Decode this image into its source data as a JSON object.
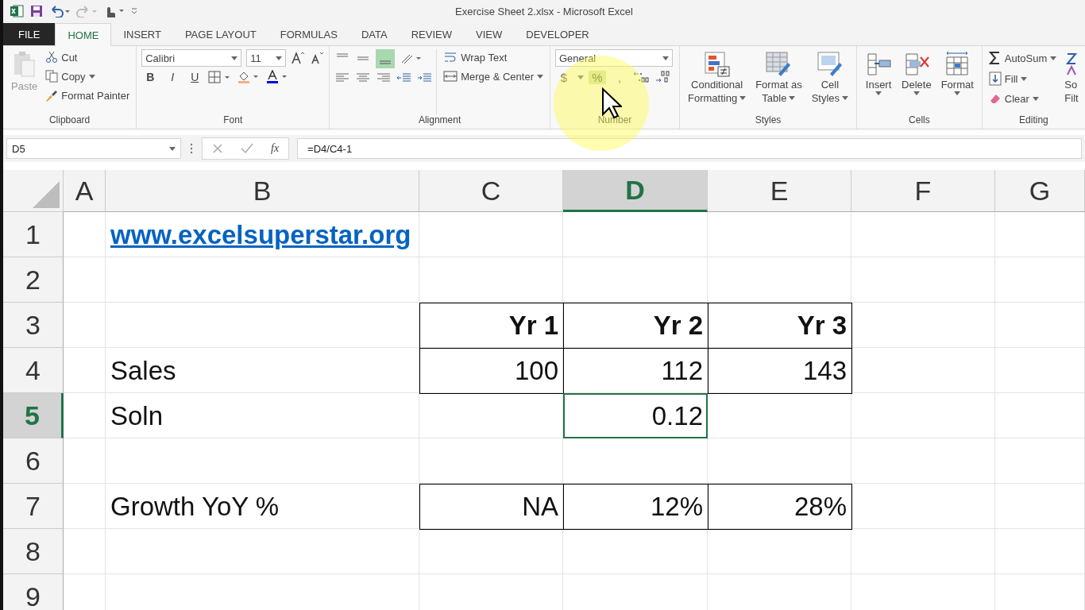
{
  "window": {
    "title": "Exercise Sheet 2.xlsx - Microsoft Excel"
  },
  "tabs": [
    {
      "label": "FILE",
      "selected": false,
      "kind": "file"
    },
    {
      "label": "HOME",
      "selected": true,
      "kind": "tab"
    },
    {
      "label": "INSERT",
      "selected": false,
      "kind": "tab"
    },
    {
      "label": "PAGE LAYOUT",
      "selected": false,
      "kind": "tab"
    },
    {
      "label": "FORMULAS",
      "selected": false,
      "kind": "tab"
    },
    {
      "label": "DATA",
      "selected": false,
      "kind": "tab"
    },
    {
      "label": "REVIEW",
      "selected": false,
      "kind": "tab"
    },
    {
      "label": "VIEW",
      "selected": false,
      "kind": "tab"
    },
    {
      "label": "DEVELOPER",
      "selected": false,
      "kind": "tab"
    }
  ],
  "ribbon": {
    "clipboard": {
      "paste": "Paste",
      "cut": "Cut",
      "copy": "Copy",
      "format_painter": "Format Painter",
      "label": "Clipboard"
    },
    "font": {
      "name": "Calibri",
      "points": "11",
      "bold": "B",
      "italic": "I",
      "underline": "U",
      "label": "Font"
    },
    "alignment": {
      "wrap_text": "Wrap Text",
      "merge": "Merge & Center",
      "label": "Alignment"
    },
    "number": {
      "format": "General",
      "currency": "$",
      "percent": "%",
      "comma": ",",
      "label": "Number"
    },
    "styles": {
      "conditional": [
        "Conditional",
        "Formatting"
      ],
      "format_table": [
        "Format as",
        "Table"
      ],
      "cell_styles": [
        "Cell",
        "Styles"
      ],
      "label": "Styles"
    },
    "cells": {
      "insert": "Insert",
      "delete": "Delete",
      "format": "Format",
      "label": "Cells"
    },
    "editing": {
      "autosum": "AutoSum",
      "fill": "Fill",
      "clear": "Clear",
      "sort": [
        "So",
        "Filt"
      ],
      "label": "Editing"
    }
  },
  "formula_bar": {
    "name_box": "D5",
    "fx": "fx",
    "formula": "=D4/C4-1"
  },
  "sheet": {
    "columns": [
      {
        "label": "A",
        "selected": false
      },
      {
        "label": "B",
        "selected": false
      },
      {
        "label": "C",
        "selected": false
      },
      {
        "label": "D",
        "selected": true
      },
      {
        "label": "E",
        "selected": false
      },
      {
        "label": "F",
        "selected": false
      },
      {
        "label": "G",
        "selected": false
      }
    ],
    "rows": [
      {
        "number": "1",
        "selected": false,
        "cells": [
          {
            "text": ""
          },
          {
            "text": "www.excelsuperstar.org",
            "kind": "link",
            "bold": true,
            "bordered": false,
            "selected": false
          }
        ]
      },
      {
        "number": "2",
        "selected": false,
        "cells": []
      },
      {
        "number": "3",
        "selected": false,
        "cells": [
          {
            "text": ""
          },
          {
            "text": ""
          },
          {
            "text": "Yr 1",
            "kind": "number",
            "bold": true,
            "bordered": true,
            "selected": false
          },
          {
            "text": "Yr 2",
            "kind": "number",
            "bold": true,
            "bordered": true,
            "selected": false
          },
          {
            "text": "Yr 3",
            "kind": "number",
            "bold": true,
            "bordered": true,
            "selected": false
          }
        ]
      },
      {
        "number": "4",
        "selected": false,
        "cells": [
          {
            "text": ""
          },
          {
            "text": "Sales",
            "kind": "label",
            "bold": false,
            "bordered": false,
            "selected": false
          },
          {
            "text": "100",
            "kind": "number",
            "bold": false,
            "bordered": true,
            "selected": false
          },
          {
            "text": "112",
            "kind": "number",
            "bold": false,
            "bordered": true,
            "selected": false
          },
          {
            "text": "143",
            "kind": "number",
            "bold": false,
            "bordered": true,
            "selected": false
          }
        ]
      },
      {
        "number": "5",
        "selected": true,
        "cells": [
          {
            "text": ""
          },
          {
            "text": "Soln",
            "kind": "label",
            "bold": false,
            "bordered": false,
            "selected": false
          },
          {
            "text": ""
          },
          {
            "text": "0.12",
            "kind": "number",
            "bold": false,
            "bordered": false,
            "selected": true
          }
        ]
      },
      {
        "number": "6",
        "selected": false,
        "cells": []
      },
      {
        "number": "7",
        "selected": false,
        "cells": [
          {
            "text": ""
          },
          {
            "text": "Growth YoY %",
            "kind": "label",
            "bold": false,
            "bordered": false,
            "selected": false
          },
          {
            "text": "NA",
            "kind": "number",
            "bold": false,
            "bordered": true,
            "selected": false
          },
          {
            "text": "12%",
            "kind": "number",
            "bold": false,
            "bordered": true,
            "selected": false
          },
          {
            "text": "28%",
            "kind": "number",
            "bold": false,
            "bordered": true,
            "selected": false
          }
        ]
      },
      {
        "number": "8",
        "selected": false,
        "cells": []
      },
      {
        "number": "9",
        "selected": false,
        "cells": []
      }
    ]
  }
}
